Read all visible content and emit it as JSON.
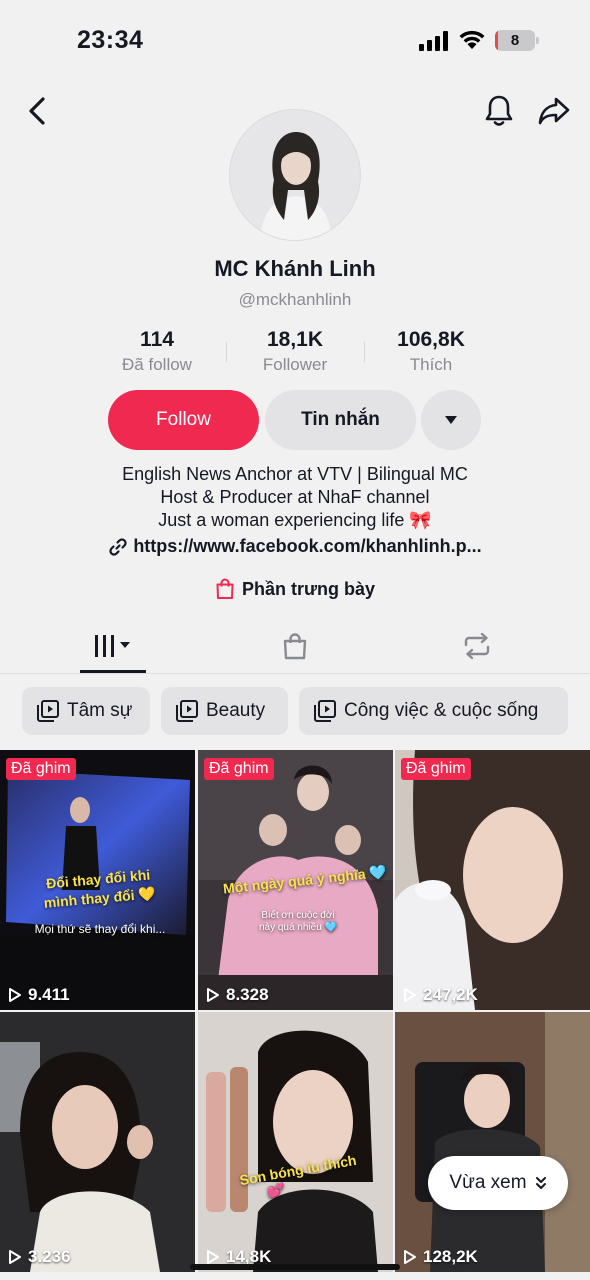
{
  "status_bar": {
    "time": "23:34",
    "battery": "8",
    "battery_level": 0.08
  },
  "profile": {
    "name": "MC Khánh Linh",
    "handle": "@mckhanhlinh",
    "stats": [
      {
        "value": "114",
        "label": "Đã follow"
      },
      {
        "value": "18,1K",
        "label": "Follower"
      },
      {
        "value": "106,8K",
        "label": "Thích"
      }
    ],
    "follow_label": "Follow",
    "message_label": "Tin nhắn",
    "bio_lines": [
      "English News Anchor at VTV | Bilingual MC",
      "Host & Producer at NhaF channel",
      "Just a woman experiencing life 🎀"
    ],
    "link": "https://www.facebook.com/khanhlinh.p...",
    "showcase_label": "Phần trưng bày"
  },
  "tabs": [
    {
      "name": "videos-tab-icon",
      "active": true
    },
    {
      "name": "shop-tab-icon",
      "active": false
    },
    {
      "name": "reposts-tab-icon",
      "active": false
    }
  ],
  "collections": [
    "Tâm sự",
    "Beauty",
    "Công việc & cuộc sống"
  ],
  "videos": [
    {
      "pinned": "Đã ghim",
      "views": "9.411",
      "caption_1": "Đổi thay đổi khi",
      "caption_2": "mình thay đổi 💛",
      "caption_3": "Mọi thứ sẽ thay đổi khi..."
    },
    {
      "pinned": "Đã ghim",
      "views": "8.328",
      "caption_1": "Một ngày quá ý nghĩa 🩵",
      "caption_2": "Biết ơn cuộc đời",
      "caption_3": "này quá nhiều 🩵"
    },
    {
      "pinned": "Đã ghim",
      "views": "247,2K"
    },
    {
      "views": "3.236"
    },
    {
      "views": "14,8K",
      "caption_1": "Son bóng iu thích",
      "caption_2": "💕"
    },
    {
      "views": "128,2K"
    }
  ],
  "recent_label": "Vừa xem",
  "colors": {
    "accent": "#ef2950",
    "pinned_badge": "#ef2950",
    "background": "#f1f1f2"
  }
}
